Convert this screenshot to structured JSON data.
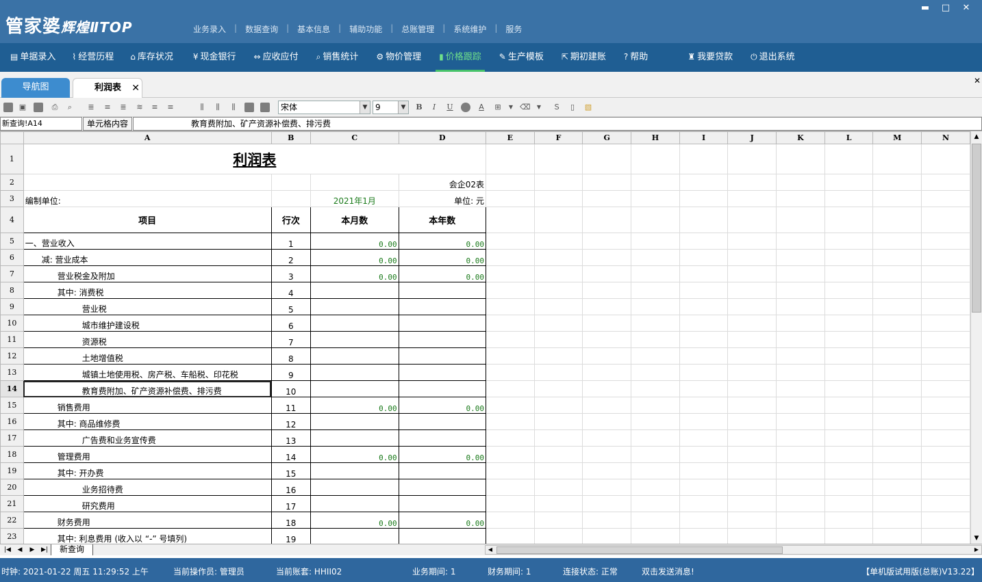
{
  "app": {
    "logo_main": "管家婆",
    "logo_sub": "辉煌ⅡTOP"
  },
  "top_menu": [
    "业务录入",
    "数据查询",
    "基本信息",
    "辅助功能",
    "总账管理",
    "系统维护",
    "服务"
  ],
  "window_controls": {
    "minimize": "▬",
    "maximize": "□",
    "close": "✕"
  },
  "nav": [
    {
      "label": "单据录入",
      "icon": "▤"
    },
    {
      "label": "经营历程",
      "icon": "⌇"
    },
    {
      "label": "库存状况",
      "icon": "⌂"
    },
    {
      "label": "现金银行",
      "icon": "¥"
    },
    {
      "label": "应收应付",
      "icon": "⇔"
    },
    {
      "label": "销售统计",
      "icon": "⌕"
    },
    {
      "label": "物价管理",
      "icon": "⚙"
    },
    {
      "label": "价格跟踪",
      "icon": "▮"
    },
    {
      "label": "生产模板",
      "icon": "✎"
    },
    {
      "label": "期初建账",
      "icon": "⇱"
    },
    {
      "label": "帮助",
      "icon": "?"
    },
    {
      "label": "我要贷款",
      "icon": "♜"
    },
    {
      "label": "退出系统",
      "icon": "⏻"
    }
  ],
  "nav_active_index": 7,
  "tabs": {
    "nav": "导航图",
    "profit": "利润表",
    "close": "✕"
  },
  "pane_close": "✕",
  "toolbar": {
    "font": "宋体",
    "size": "9",
    "bold": "B",
    "italic": "I",
    "underline": "U"
  },
  "formula": {
    "cell_ref": "新查询!A14",
    "label": "单元格内容",
    "value": "教育费附加、矿产资源补偿费、排污费"
  },
  "columns": [
    "A",
    "B",
    "C",
    "D",
    "E",
    "F",
    "G",
    "H",
    "I",
    "J",
    "K",
    "L",
    "M",
    "N"
  ],
  "sheet": {
    "title": "利润表",
    "form_code": "会企02表",
    "unit_label": "编制单位:",
    "period": "2021年1月",
    "currency_unit": "单位: 元",
    "headers": [
      "项目",
      "行次",
      "本月数",
      "本年数"
    ],
    "rows": [
      {
        "item": "一、营业收入",
        "line": "1",
        "month": "0.00",
        "year": "0.00",
        "indent": 0
      },
      {
        "item": "减: 营业成本",
        "line": "2",
        "month": "0.00",
        "year": "0.00",
        "indent": 1
      },
      {
        "item": "营业税金及附加",
        "line": "3",
        "month": "0.00",
        "year": "0.00",
        "indent": 2
      },
      {
        "item": "其中: 消费税",
        "line": "4",
        "month": "",
        "year": "",
        "indent": 2
      },
      {
        "item": "营业税",
        "line": "5",
        "month": "",
        "year": "",
        "indent": 3
      },
      {
        "item": "城市维护建设税",
        "line": "6",
        "month": "",
        "year": "",
        "indent": 3
      },
      {
        "item": "资源税",
        "line": "7",
        "month": "",
        "year": "",
        "indent": 3
      },
      {
        "item": "土地增值税",
        "line": "8",
        "month": "",
        "year": "",
        "indent": 3
      },
      {
        "item": "城镇土地使用税、房产税、车船税、印花税",
        "line": "9",
        "month": "",
        "year": "",
        "indent": 3
      },
      {
        "item": "教育费附加、矿产资源补偿费、排污费",
        "line": "10",
        "month": "",
        "year": "",
        "indent": 3
      },
      {
        "item": "销售费用",
        "line": "11",
        "month": "0.00",
        "year": "0.00",
        "indent": 2
      },
      {
        "item": "其中: 商品维修费",
        "line": "12",
        "month": "",
        "year": "",
        "indent": 2
      },
      {
        "item": "广告费和业务宣传费",
        "line": "13",
        "month": "",
        "year": "",
        "indent": 3
      },
      {
        "item": "管理费用",
        "line": "14",
        "month": "0.00",
        "year": "0.00",
        "indent": 2
      },
      {
        "item": "其中: 开办费",
        "line": "15",
        "month": "",
        "year": "",
        "indent": 2
      },
      {
        "item": "业务招待费",
        "line": "16",
        "month": "",
        "year": "",
        "indent": 3
      },
      {
        "item": "研究费用",
        "line": "17",
        "month": "",
        "year": "",
        "indent": 3
      },
      {
        "item": "财务费用",
        "line": "18",
        "month": "0.00",
        "year": "0.00",
        "indent": 2
      },
      {
        "item": "其中: 利息费用 (收入以 “-” 号填列)",
        "line": "19",
        "month": "",
        "year": "",
        "indent": 2
      }
    ],
    "selected_row": 14
  },
  "sheet_tab": "新查询",
  "status": {
    "clock": "时钟: 2021-01-22 周五 11:29:52 上午",
    "operator": "当前操作员: 管理员",
    "account": "当前账套: HHII02",
    "period": "业务期间: 1",
    "finance_period": "财务期间: 1",
    "connection": "连接状态: 正常",
    "message": "双击发送消息!",
    "version": "【单机版试用版(总账)V13.22】"
  }
}
